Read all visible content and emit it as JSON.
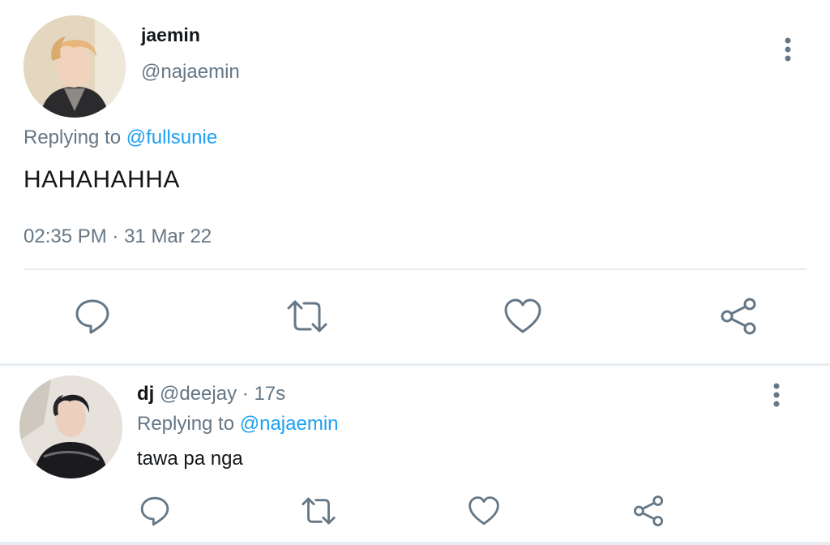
{
  "main_tweet": {
    "author_name": "jaemin",
    "handle": "@najaemin",
    "replying_label": "Replying to",
    "replying_to": "@fullsunie",
    "text": "HAHAHAHHA",
    "time": "02:35 PM",
    "separator": "·",
    "date": "31 Mar 22"
  },
  "reply_tweet": {
    "author_name": "dj",
    "handle": "@deejay",
    "separator": "·",
    "age": "17s",
    "replying_label": "Replying to",
    "replying_to": "@najaemin",
    "text": "tawa pa nga"
  },
  "actions": [
    "reply-icon",
    "retweet-icon",
    "like-icon",
    "share-icon"
  ],
  "colors": {
    "text": "#14171a",
    "secondary": "#657786",
    "link": "#1da1f2",
    "icon": "#657786",
    "divider": "#e6ecf0"
  }
}
